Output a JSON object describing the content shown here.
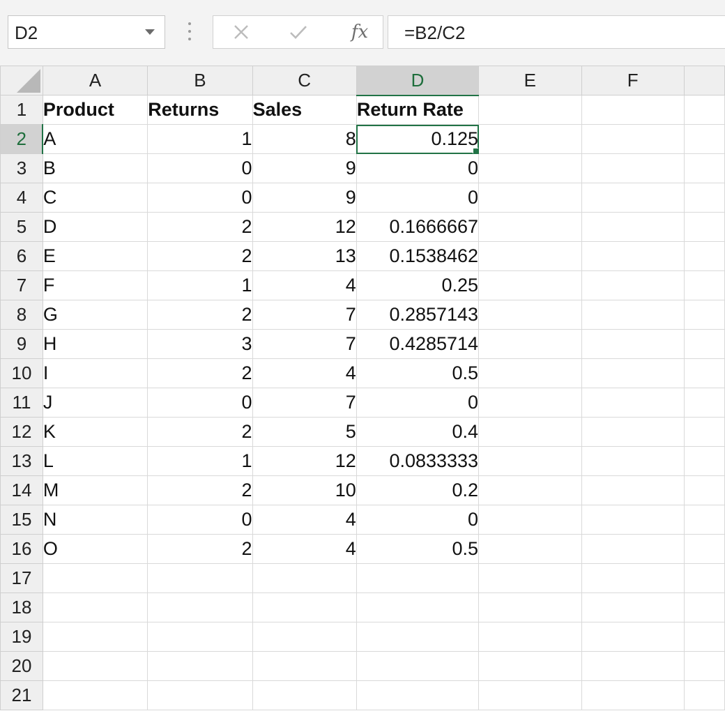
{
  "name_box": {
    "value": "D2"
  },
  "formula_bar": {
    "cancel_icon": "close-icon",
    "enter_icon": "checkmark-icon",
    "fx_label": "fx",
    "formula": "=B2/C2"
  },
  "columns": [
    "A",
    "B",
    "C",
    "D",
    "E",
    "F"
  ],
  "selected_cell": {
    "column": "D",
    "row": "2"
  },
  "accent_color": "#217346",
  "rows": [
    {
      "num": "1",
      "cells": [
        "Product",
        "Returns",
        "Sales",
        "Return Rate",
        "",
        ""
      ]
    },
    {
      "num": "2",
      "cells": [
        "A",
        "1",
        "8",
        "0.125",
        "",
        ""
      ]
    },
    {
      "num": "3",
      "cells": [
        "B",
        "0",
        "9",
        "0",
        "",
        ""
      ]
    },
    {
      "num": "4",
      "cells": [
        "C",
        "0",
        "9",
        "0",
        "",
        ""
      ]
    },
    {
      "num": "5",
      "cells": [
        "D",
        "2",
        "12",
        "0.1666667",
        "",
        ""
      ]
    },
    {
      "num": "6",
      "cells": [
        "E",
        "2",
        "13",
        "0.1538462",
        "",
        ""
      ]
    },
    {
      "num": "7",
      "cells": [
        "F",
        "1",
        "4",
        "0.25",
        "",
        ""
      ]
    },
    {
      "num": "8",
      "cells": [
        "G",
        "2",
        "7",
        "0.2857143",
        "",
        ""
      ]
    },
    {
      "num": "9",
      "cells": [
        "H",
        "3",
        "7",
        "0.4285714",
        "",
        ""
      ]
    },
    {
      "num": "10",
      "cells": [
        "I",
        "2",
        "4",
        "0.5",
        "",
        ""
      ]
    },
    {
      "num": "11",
      "cells": [
        "J",
        "0",
        "7",
        "0",
        "",
        ""
      ]
    },
    {
      "num": "12",
      "cells": [
        "K",
        "2",
        "5",
        "0.4",
        "",
        ""
      ]
    },
    {
      "num": "13",
      "cells": [
        "L",
        "1",
        "12",
        "0.0833333",
        "",
        ""
      ]
    },
    {
      "num": "14",
      "cells": [
        "M",
        "2",
        "10",
        "0.2",
        "",
        ""
      ]
    },
    {
      "num": "15",
      "cells": [
        "N",
        "0",
        "4",
        "0",
        "",
        ""
      ]
    },
    {
      "num": "16",
      "cells": [
        "O",
        "2",
        "4",
        "0.5",
        "",
        ""
      ]
    },
    {
      "num": "17",
      "cells": [
        "",
        "",
        "",
        "",
        "",
        ""
      ]
    },
    {
      "num": "18",
      "cells": [
        "",
        "",
        "",
        "",
        "",
        ""
      ]
    },
    {
      "num": "19",
      "cells": [
        "",
        "",
        "",
        "",
        "",
        ""
      ]
    },
    {
      "num": "20",
      "cells": [
        "",
        "",
        "",
        "",
        "",
        ""
      ]
    },
    {
      "num": "21",
      "cells": [
        "",
        "",
        "",
        "",
        "",
        ""
      ]
    }
  ]
}
